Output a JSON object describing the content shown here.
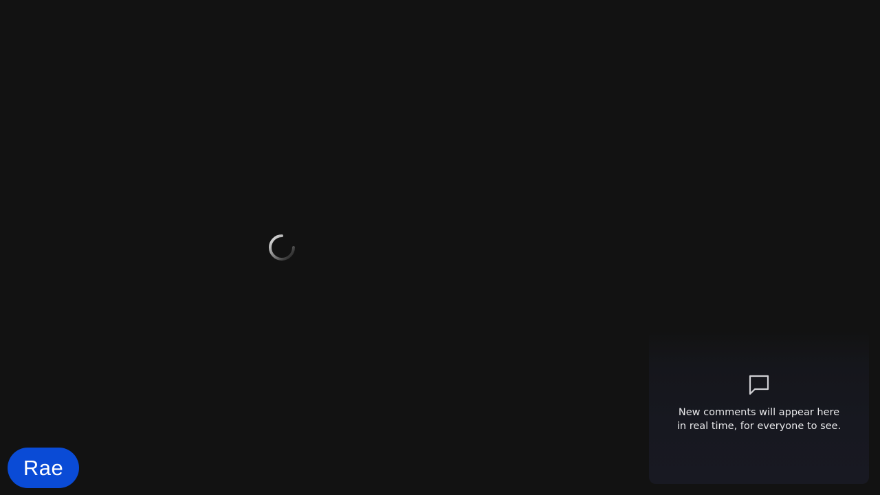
{
  "loading": {
    "icon": "loading-spinner-icon"
  },
  "comments": {
    "icon": "chat-bubble-icon",
    "empty_line1": "New comments will appear here",
    "empty_line2": "in real time, for everyone to see."
  },
  "user": {
    "name": "Rae",
    "badge_color": "#0a4bd6"
  },
  "colors": {
    "background": "#121212",
    "panel": "#181922",
    "text": "#e8e8ea"
  }
}
